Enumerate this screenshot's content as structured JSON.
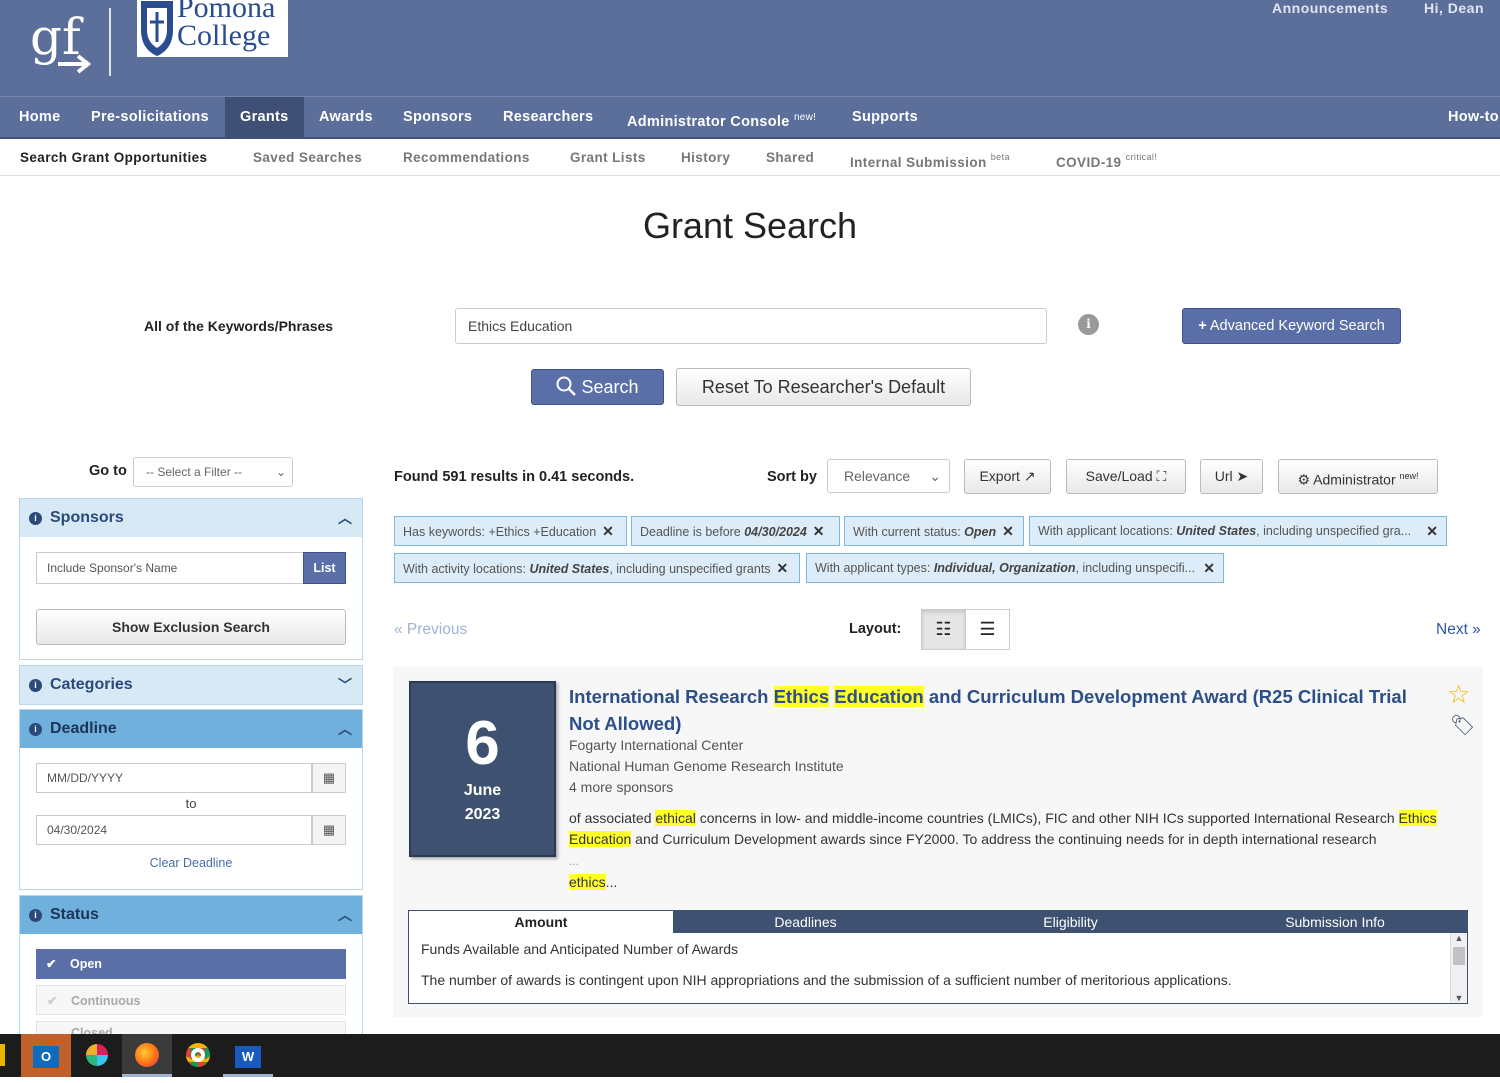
{
  "header": {
    "gf_logo_text": "gf",
    "college_name_line1": "Pomona",
    "college_name_line2": "College",
    "announcements": "Announcements",
    "greeting": "Hi, Dean"
  },
  "main_nav": [
    {
      "label": "Home",
      "badge": ""
    },
    {
      "label": "Pre-solicitations",
      "badge": ""
    },
    {
      "label": "Grants",
      "badge": ""
    },
    {
      "label": "Awards",
      "badge": ""
    },
    {
      "label": "Sponsors",
      "badge": ""
    },
    {
      "label": "Researchers",
      "badge": ""
    },
    {
      "label": "Administrator Console",
      "badge": "new!"
    },
    {
      "label": "Supports",
      "badge": ""
    },
    {
      "label": "How-to",
      "badge": ""
    }
  ],
  "sub_nav": [
    {
      "label": "Search Grant Opportunities",
      "badge": ""
    },
    {
      "label": "Saved Searches",
      "badge": ""
    },
    {
      "label": "Recommendations",
      "badge": ""
    },
    {
      "label": "Grant Lists",
      "badge": ""
    },
    {
      "label": "History",
      "badge": ""
    },
    {
      "label": "Shared",
      "badge": ""
    },
    {
      "label": "Internal Submission",
      "badge": "beta"
    },
    {
      "label": "COVID-19",
      "badge": "critical!"
    }
  ],
  "search": {
    "title": "Grant Search",
    "keywords_label": "All of the Keywords/Phrases",
    "keywords_value": "Ethics Education",
    "info_icon": "i",
    "advanced_label": "Advanced Keyword Search",
    "search_label": "Search",
    "reset_label": "Reset To Researcher's Default"
  },
  "sidebar": {
    "goto_label": "Go to",
    "goto_placeholder": "-- Select a Filter --",
    "sponsors": {
      "title": "Sponsors",
      "name_placeholder": "Include Sponsor's Name",
      "list_label": "List",
      "exclusion_label": "Show Exclusion Search"
    },
    "categories": {
      "title": "Categories"
    },
    "deadline": {
      "title": "Deadline",
      "from_placeholder": "MM/DD/YYYY",
      "to_label": "to",
      "to_value": "04/30/2024",
      "clear_label": "Clear Deadline"
    },
    "status": {
      "title": "Status",
      "options": [
        {
          "label": "Open",
          "checked": true
        },
        {
          "label": "Continuous",
          "checked": false
        },
        {
          "label": "Closed",
          "checked": false
        }
      ]
    }
  },
  "results": {
    "count_text": "Found 591 results in 0.41 seconds.",
    "sort_label": "Sort by",
    "sort_value": "Relevance",
    "export_label": "Export",
    "saveload_label": "Save/Load",
    "url_label": "Url",
    "admin_label": "Administrator",
    "admin_badge": "new!",
    "filters": [
      {
        "prefix": "Has keywords: +Ethics +Education",
        "em": "",
        "suffix": ""
      },
      {
        "prefix": "Deadline is before ",
        "em": "04/30/2024",
        "suffix": ""
      },
      {
        "prefix": "With current status: ",
        "em": "Open",
        "suffix": ""
      },
      {
        "prefix": "With applicant locations: ",
        "em": "United States",
        "suffix": ", including unspecified gra..."
      },
      {
        "prefix": "With activity locations: ",
        "em": "United States",
        "suffix": ", including unspecified grants"
      },
      {
        "prefix": "With applicant types: ",
        "em": "Individual, Organization",
        "suffix": ", including unspecifi..."
      }
    ],
    "previous_label": "« Previous",
    "next_label": "Next »",
    "layout_label": "Layout:"
  },
  "grant": {
    "day": "6",
    "month": "June",
    "year": "2023",
    "title_pre": "International Research ",
    "title_hl1": "Ethics",
    "title_sp": " ",
    "title_hl2": "Education",
    "title_post": " and Curriculum Development Award (R25 Clinical Trial Not Allowed)",
    "sponsors": [
      "Fogarty International Center",
      "National Human Genome Research Institute"
    ],
    "more_sponsors": "4 more sponsors",
    "excerpt_1": "of associated ",
    "excerpt_hl1": "ethical",
    "excerpt_2": " concerns in low- and middle-income countries (LMICs), FIC and other NIH ICs supported International Research ",
    "excerpt_hl2": "Ethics",
    "excerpt_3": " ",
    "excerpt_hl3": "Education",
    "excerpt_4": " and Curriculum Development awards since FY2000. To address the continuing needs for in depth international research",
    "excerpt_ellipsis": "...",
    "excerpt_hl4": "ethics",
    "excerpt_end": "...",
    "tabs": [
      "Amount",
      "Deadlines",
      "Eligibility",
      "Submission Info"
    ],
    "amount_heading": "Funds Available and Anticipated Number of Awards",
    "amount_text": "The number of awards is contingent upon NIH appropriations and the submission of a sufficient number of meritorious applications."
  },
  "taskbar": {
    "apps": [
      "outlook-icon",
      "slack-icon",
      "firefox-icon",
      "chrome-icon",
      "word-icon"
    ]
  }
}
